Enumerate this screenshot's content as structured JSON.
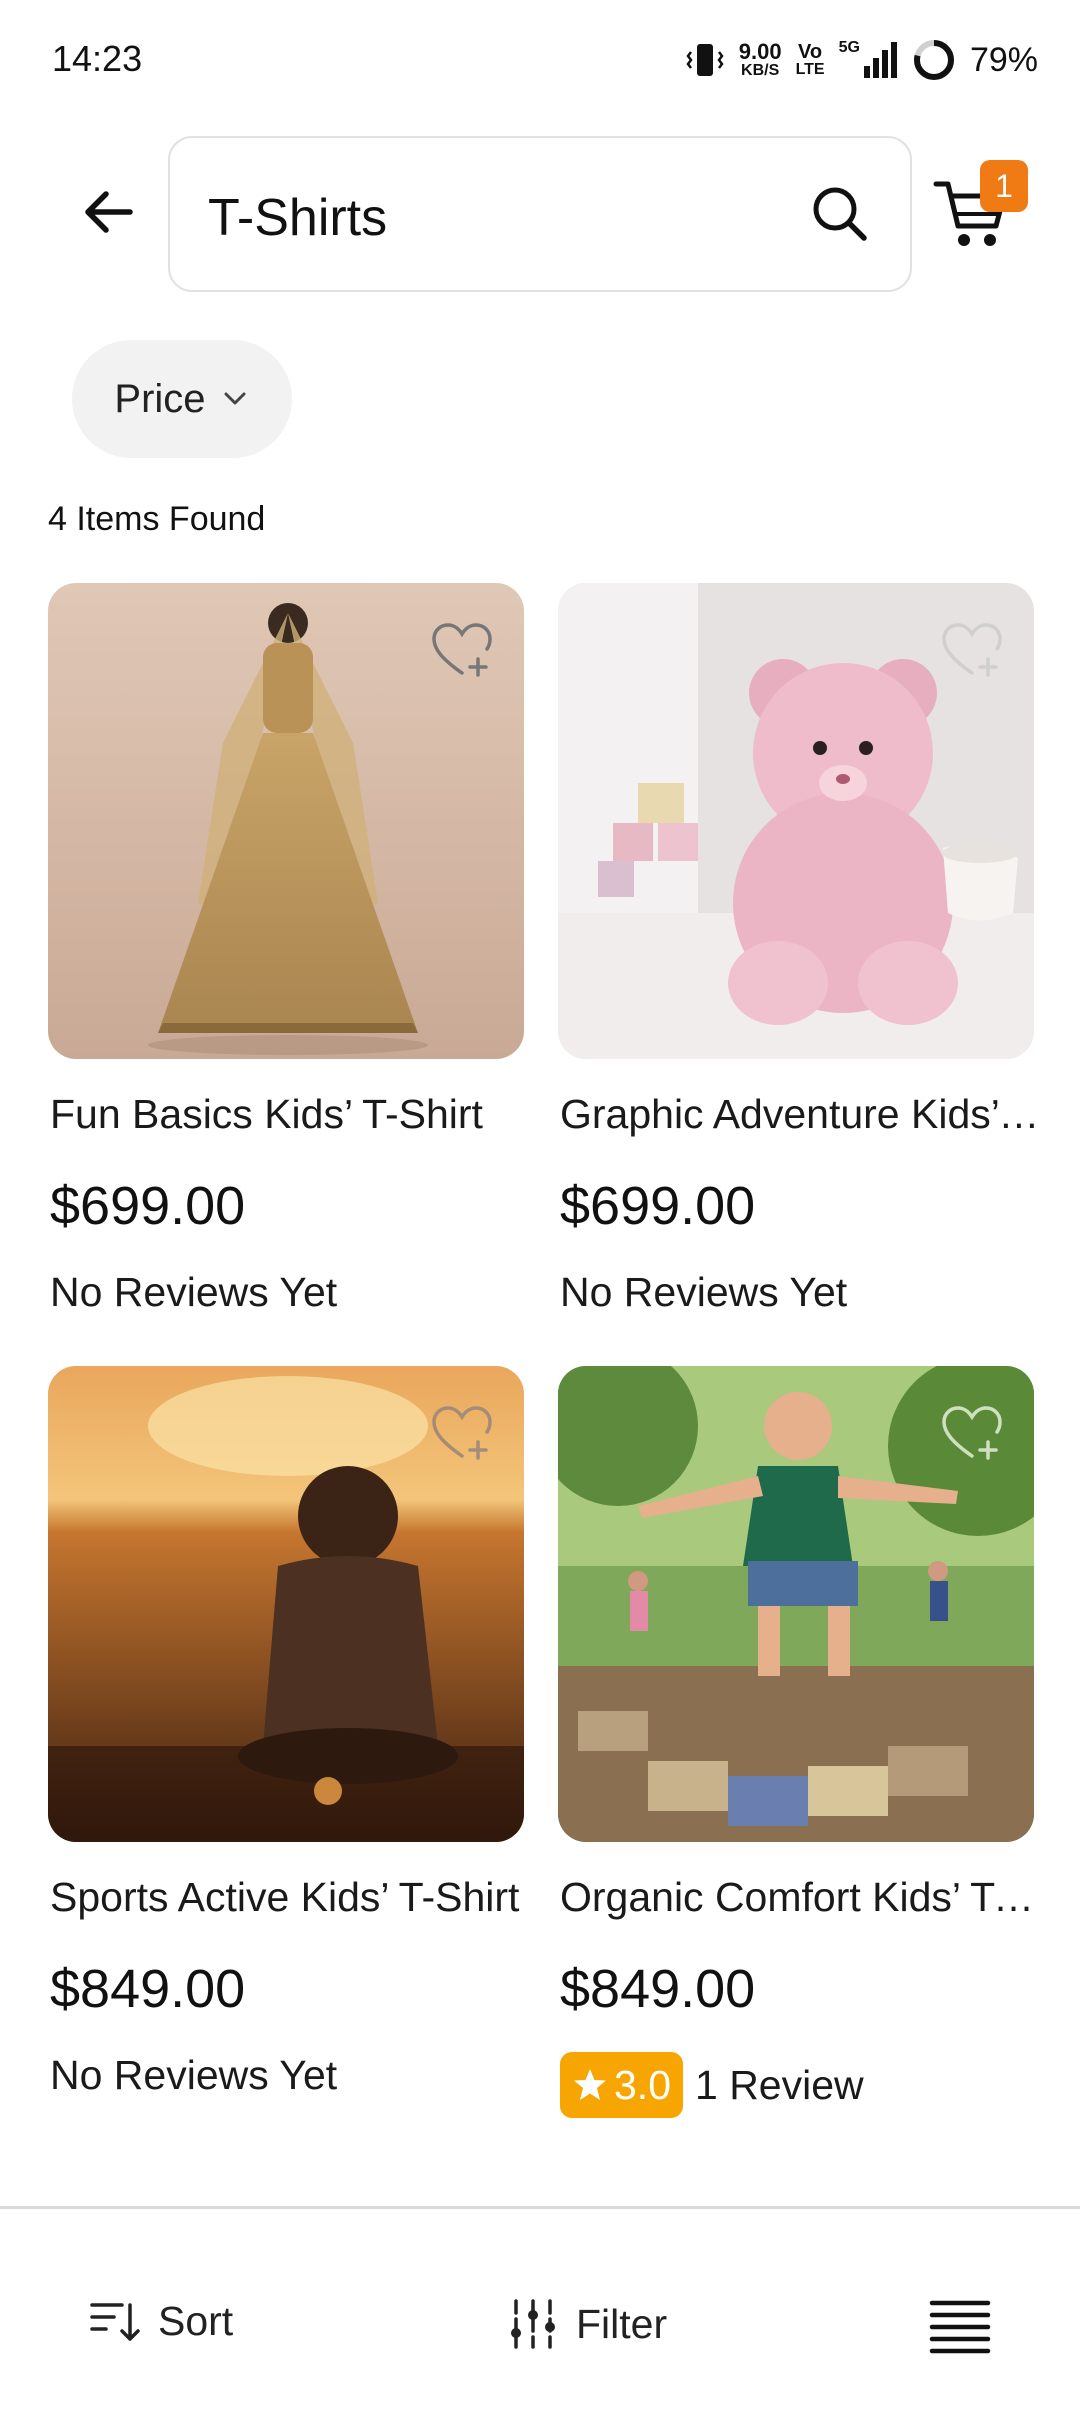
{
  "status_bar": {
    "time": "14:23",
    "net_speed_value": "9.00",
    "net_speed_unit": "KB/S",
    "volte_top": "Vo",
    "volte_bottom": "LTE",
    "network": "5G",
    "battery": "79%",
    "icons": [
      "vibrate-icon",
      "signal-icon",
      "battery-ring-icon"
    ]
  },
  "header": {
    "search_query": "T-Shirts",
    "cart_count": "1",
    "icons": [
      "back-arrow-icon",
      "search-icon",
      "cart-icon"
    ]
  },
  "filters": {
    "price_chip_label": "Price"
  },
  "results": {
    "count_label": "4 Items Found"
  },
  "products": [
    {
      "name": "Fun Basics Kids’ T-Shirt",
      "price": "$699.00",
      "reviews": "No Reviews Yet"
    },
    {
      "name": "Graphic Adventure Kids’ T-Shirt",
      "price": "$699.00",
      "reviews": "No Reviews Yet"
    },
    {
      "name": "Sports Active Kids’ T-Shirt",
      "price": "$849.00",
      "reviews": "No Reviews Yet"
    },
    {
      "name": "Organic Comfort Kids’ T-Shirt",
      "price": "$849.00",
      "rating": "3.0",
      "reviews": "1 Review"
    }
  ],
  "bottom_bar": {
    "sort_label": "Sort",
    "filter_label": "Filter",
    "icons": [
      "sort-icon",
      "filter-sliders-icon",
      "list-layout-icon"
    ]
  },
  "colors": {
    "accent_orange": "#f07a14",
    "rating_badge": "#f7a500",
    "chip_bg": "#f2f2f2",
    "divider": "#d9d9d9"
  }
}
